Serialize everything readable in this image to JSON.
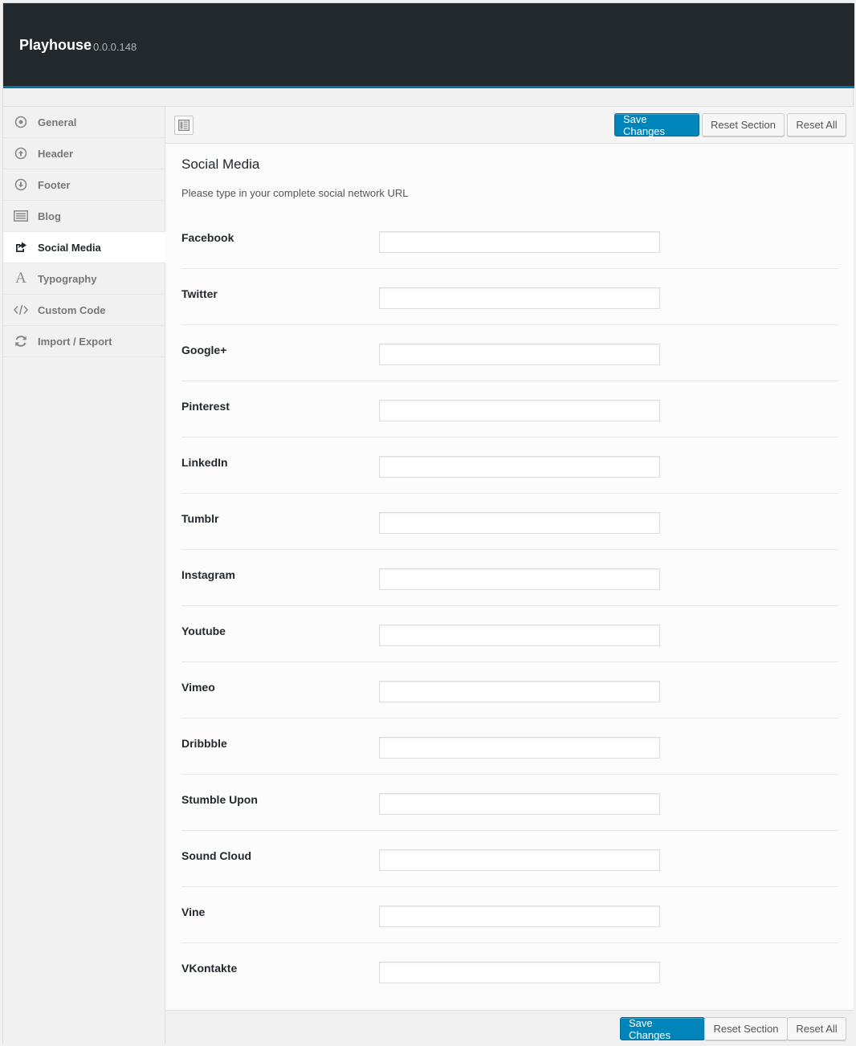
{
  "header": {
    "title": "Playhouse",
    "version": "0.0.0.148"
  },
  "sidebar": {
    "items": [
      {
        "label": "General",
        "icon": "circle-dot-icon",
        "active": false
      },
      {
        "label": "Header",
        "icon": "arrow-up-circle-icon",
        "active": false
      },
      {
        "label": "Footer",
        "icon": "arrow-down-circle-icon",
        "active": false
      },
      {
        "label": "Blog",
        "icon": "list-icon",
        "active": false
      },
      {
        "label": "Social Media",
        "icon": "share-icon",
        "active": true
      },
      {
        "label": "Typography",
        "icon": "font-icon",
        "active": false
      },
      {
        "label": "Custom Code",
        "icon": "code-icon",
        "active": false
      },
      {
        "label": "Import / Export",
        "icon": "refresh-icon",
        "active": false
      }
    ]
  },
  "toolbar": {
    "save_label": "Save Changes",
    "reset_section_label": "Reset Section",
    "reset_all_label": "Reset All"
  },
  "section": {
    "title": "Social Media",
    "description": "Please type in your complete social network URL"
  },
  "fields": [
    {
      "label": "Facebook",
      "value": ""
    },
    {
      "label": "Twitter",
      "value": ""
    },
    {
      "label": "Google+",
      "value": ""
    },
    {
      "label": "Pinterest",
      "value": ""
    },
    {
      "label": "LinkedIn",
      "value": ""
    },
    {
      "label": "Tumblr",
      "value": ""
    },
    {
      "label": "Instagram",
      "value": ""
    },
    {
      "label": "Youtube",
      "value": ""
    },
    {
      "label": "Vimeo",
      "value": ""
    },
    {
      "label": "Dribbble",
      "value": ""
    },
    {
      "label": "Stumble Upon",
      "value": ""
    },
    {
      "label": "Sound Cloud",
      "value": ""
    },
    {
      "label": "Vine",
      "value": ""
    },
    {
      "label": "VKontakte",
      "value": ""
    }
  ],
  "colors": {
    "topbar": "#23282d",
    "accent": "#0073aa",
    "primary_button": "#0085ba"
  }
}
